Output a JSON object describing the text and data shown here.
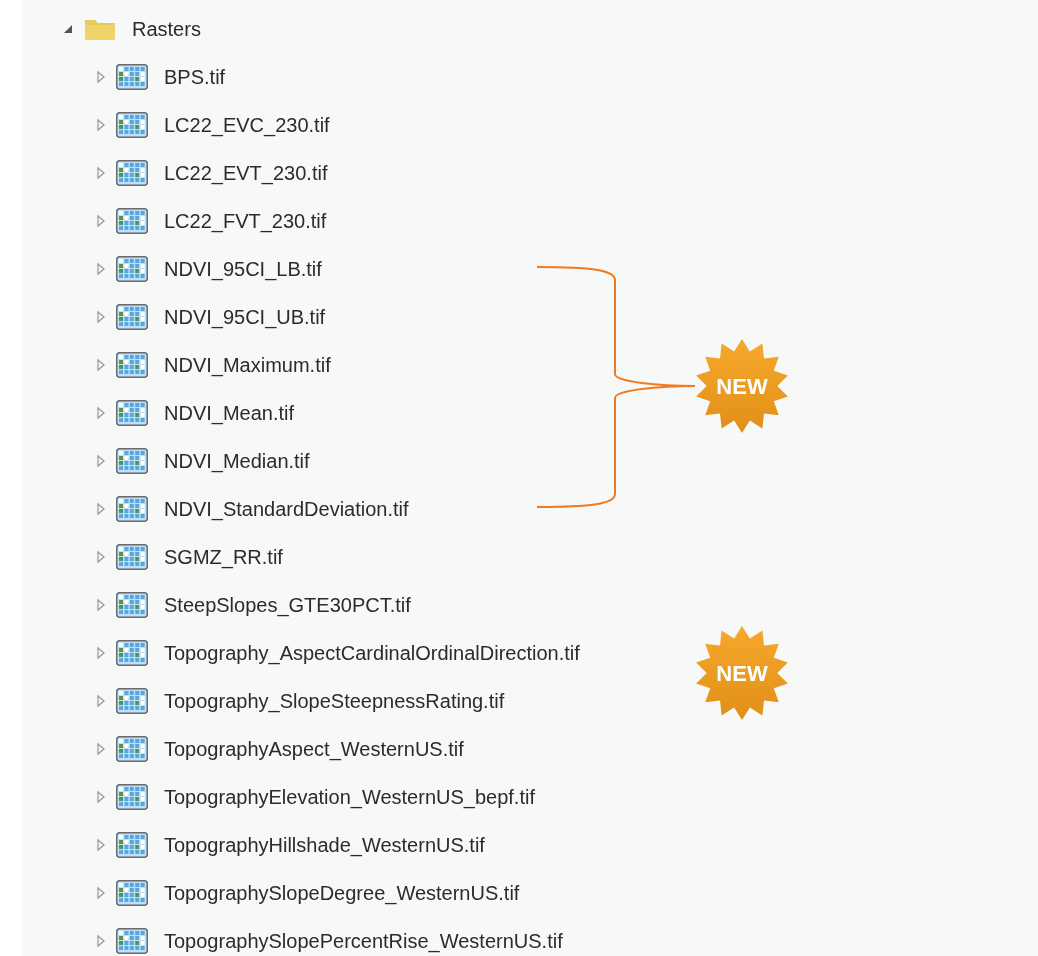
{
  "tree": {
    "label": "Rasters",
    "expanded": true,
    "children": [
      {
        "label": "BPS.tif",
        "expanded": false
      },
      {
        "label": "LC22_EVC_230.tif",
        "expanded": false
      },
      {
        "label": "LC22_EVT_230.tif",
        "expanded": false
      },
      {
        "label": "LC22_FVT_230.tif",
        "expanded": false
      },
      {
        "label": "NDVI_95CI_LB.tif",
        "expanded": false
      },
      {
        "label": "NDVI_95CI_UB.tif",
        "expanded": false
      },
      {
        "label": "NDVI_Maximum.tif",
        "expanded": false
      },
      {
        "label": "NDVI_Mean.tif",
        "expanded": false
      },
      {
        "label": "NDVI_Median.tif",
        "expanded": false
      },
      {
        "label": "NDVI_StandardDeviation.tif",
        "expanded": false
      },
      {
        "label": "SGMZ_RR.tif",
        "expanded": false
      },
      {
        "label": "SteepSlopes_GTE30PCT.tif",
        "expanded": false
      },
      {
        "label": "Topography_AspectCardinalOrdinalDirection.tif",
        "expanded": false
      },
      {
        "label": "Topography_SlopeSteepnessRating.tif",
        "expanded": false
      },
      {
        "label": "TopographyAspect_WesternUS.tif",
        "expanded": false
      },
      {
        "label": "TopographyElevation_WesternUS_bepf.tif",
        "expanded": false
      },
      {
        "label": "TopographyHillshade_WesternUS.tif",
        "expanded": false
      },
      {
        "label": "TopographySlopeDegree_WesternUS.tif",
        "expanded": false
      },
      {
        "label": "TopographySlopePercentRise_WesternUS.tif",
        "expanded": false
      }
    ]
  },
  "badges": [
    {
      "text": "NEW"
    },
    {
      "text": "NEW"
    }
  ]
}
